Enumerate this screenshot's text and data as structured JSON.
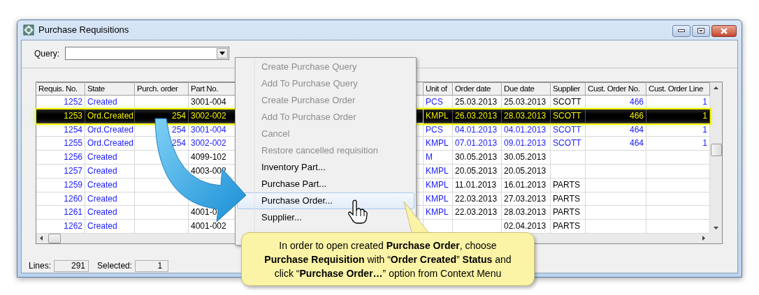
{
  "window": {
    "title": "Purchase Requisitions"
  },
  "query": {
    "label": "Query:"
  },
  "table": {
    "columns": [
      "Requis. No.",
      "State",
      "Purch. order",
      "Part No.",
      "Unit of",
      "Order date",
      "Due date",
      "Supplier",
      "Cust. Order No.",
      "Cust. Order Line"
    ],
    "rows": [
      {
        "cells": [
          "1252",
          "Created",
          null,
          "3001-004",
          "PCS",
          "25.03.2013",
          "25.03.2013",
          "SCOTT",
          "466",
          "1"
        ],
        "selected": false,
        "highlighted": false
      },
      {
        "cells": [
          "1253",
          "Ord.Created",
          "254",
          "3002-002",
          "KMPL",
          "26.03.2013",
          "28.03.2013",
          "SCOTT",
          "466",
          "1"
        ],
        "selected": true
      },
      {
        "cells": [
          "1254",
          "Ord.Created",
          "254",
          "3001-004",
          "PCS",
          "04.01.2013",
          "04.01.2013",
          "SCOTT",
          "464",
          "1"
        ],
        "selected": false,
        "highlighted": true
      },
      {
        "cells": [
          "1255",
          "Ord.Created",
          "254",
          "3002-002",
          "KMPL",
          "07.01.2013",
          "09.01.2013",
          "SCOTT",
          "464",
          "1"
        ],
        "selected": false,
        "highlighted": true
      },
      {
        "cells": [
          "1256",
          "Created",
          null,
          "4099-102",
          "M",
          "30.05.2013",
          "30.05.2013",
          null,
          null,
          null
        ],
        "selected": false,
        "highlighted": false
      },
      {
        "cells": [
          "1257",
          "Created",
          null,
          "4003-002",
          "KMPL",
          "20.05.2013",
          "20.05.2013",
          null,
          null,
          null
        ],
        "selected": false,
        "highlighted": false
      },
      {
        "cells": [
          "1259",
          "Created",
          null,
          null,
          "KMPL",
          "11.01.2013",
          "16.01.2013",
          "PARTS",
          null,
          null
        ],
        "selected": false,
        "highlighted": false
      },
      {
        "cells": [
          "1260",
          "Created",
          null,
          null,
          "KMPL",
          "22.03.2013",
          "27.03.2013",
          "PARTS",
          null,
          null
        ],
        "selected": false,
        "highlighted": false
      },
      {
        "cells": [
          "1261",
          "Created",
          null,
          "4001-0",
          "KMPL",
          "22.03.2013",
          "28.03.2013",
          "PARTS",
          null,
          null
        ],
        "selected": false,
        "highlighted": false
      },
      {
        "cells": [
          "1262",
          "Created",
          null,
          "4001-002",
          null,
          null,
          "02.04.2013",
          "PARTS",
          null,
          null
        ],
        "selected": false,
        "highlighted": false
      }
    ]
  },
  "context_menu": {
    "items": [
      {
        "label": "Create Purchase Query",
        "disabled": true,
        "highlighted": false
      },
      {
        "label": "Add To Purchase Query",
        "disabled": true,
        "highlighted": false
      },
      {
        "label": "Create Purchase Order",
        "disabled": true,
        "highlighted": false
      },
      {
        "label": "Add To Purchase Order",
        "disabled": true,
        "highlighted": false
      },
      {
        "label": "Cancel",
        "disabled": true,
        "highlighted": false
      },
      {
        "label": "Restore cancelled requisition",
        "disabled": true,
        "highlighted": false
      },
      {
        "label": "Inventory Part...",
        "disabled": false,
        "highlighted": false
      },
      {
        "label": "Purchase Part...",
        "disabled": false,
        "highlighted": false
      },
      {
        "label": "Purchase Order...",
        "disabled": false,
        "highlighted": true
      },
      {
        "label": "Supplier...",
        "disabled": false,
        "highlighted": false
      }
    ]
  },
  "status_bar": {
    "lines_label": "Lines:",
    "lines": "291",
    "selected_label": "Selected:",
    "selected": "1"
  },
  "callout": {
    "text": "In order to open created **Purchase Order**, choose\n**Purchase Requisition** with “**Order Created**” **Status** and\nclick “**Purchase Order…**” option from Context Menu"
  }
}
